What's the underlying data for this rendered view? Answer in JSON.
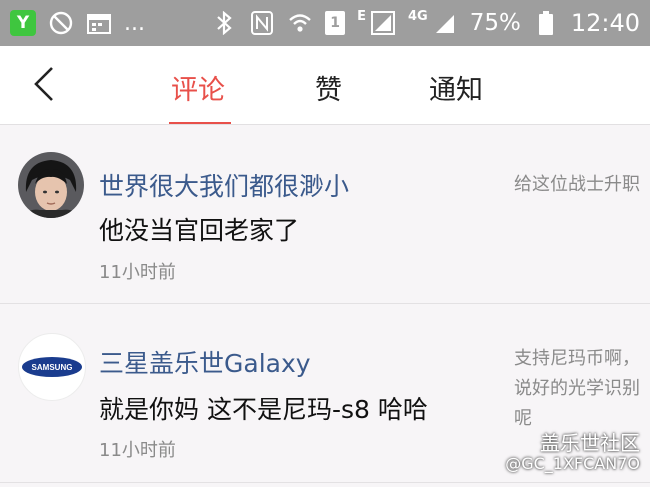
{
  "status_bar": {
    "dots": "...",
    "signal_label_e": "E",
    "sim_number": "1",
    "signal_label_4g": "4G",
    "battery": "75%",
    "time": "12:40"
  },
  "header": {
    "tabs": [
      {
        "label": "评论",
        "active": true
      },
      {
        "label": "赞",
        "active": false
      },
      {
        "label": "通知",
        "active": false
      }
    ]
  },
  "comments": [
    {
      "user": "世界很大我们都很渺小",
      "content": "他没当官回老家了",
      "time": "11小时前",
      "reference": "给这位战士升职"
    },
    {
      "user": "三星盖乐世Galaxy",
      "content": "就是你妈 这不是尼玛-s8 哈哈",
      "time": "11小时前",
      "reference": "支持尼玛币啊，说好的光学识别呢",
      "avatar_logo_text": "SAMSUNG"
    }
  ],
  "watermark": {
    "line1": "盖乐世社区",
    "line2": "@GC_1XFCAN7O"
  },
  "colors": {
    "accent": "#e8504a",
    "username": "#3b5a8c",
    "statusbar_bg": "#9e9e9e"
  }
}
